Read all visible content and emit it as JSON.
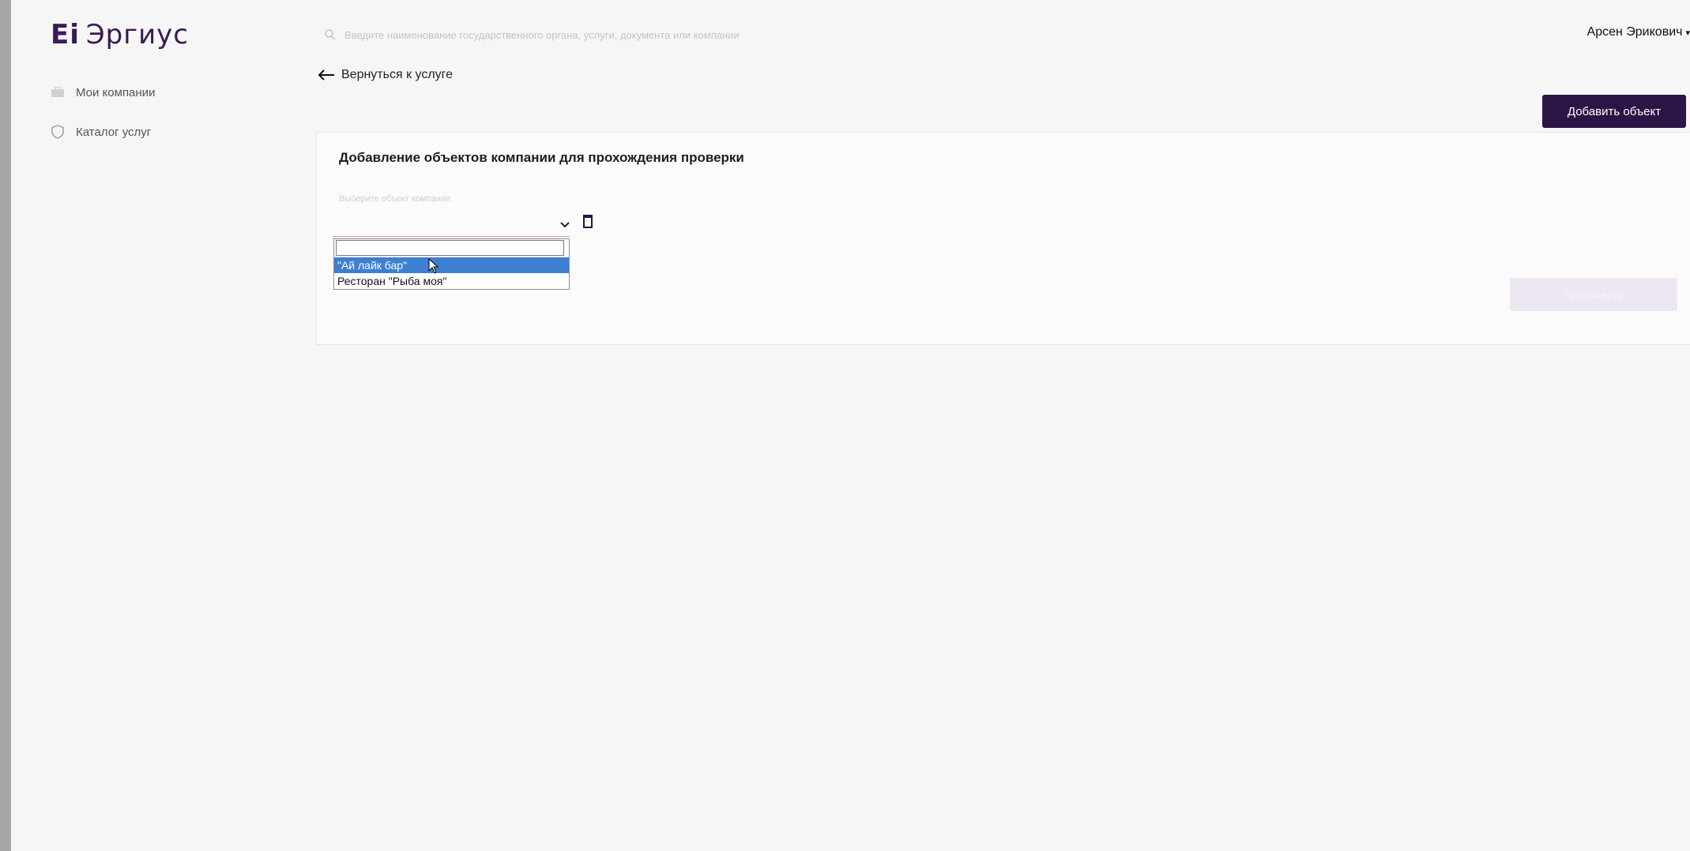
{
  "app": {
    "logo_mark": "Ei",
    "logo_text": "Эргиус"
  },
  "header": {
    "search_placeholder": "Введите наименование государственного органа, услуги, документа или компании",
    "user_name": "Арсен Эрикович"
  },
  "sidebar": {
    "items": [
      {
        "label": "Мои компании",
        "icon": "briefcase-icon"
      },
      {
        "label": "Каталог услуг",
        "icon": "shield-icon"
      }
    ]
  },
  "nav": {
    "back_label": "Вернуться к услуге"
  },
  "toolbar": {
    "add_object_label": "Добавить объект"
  },
  "form": {
    "title": "Добавление объектов компании для прохождения проверки",
    "field_label": "Выберите объект компании",
    "dropdown_options": [
      "\"Ай лайк бар\"",
      "Ресторан \"Рыба моя\""
    ],
    "highlighted_option": "\"Ай лайк бар\"",
    "next_button_label": "Продолжить"
  },
  "colors": {
    "brand": "#2c1447",
    "highlight": "#3d7fd1",
    "page_bg": "#f6f6f6"
  }
}
